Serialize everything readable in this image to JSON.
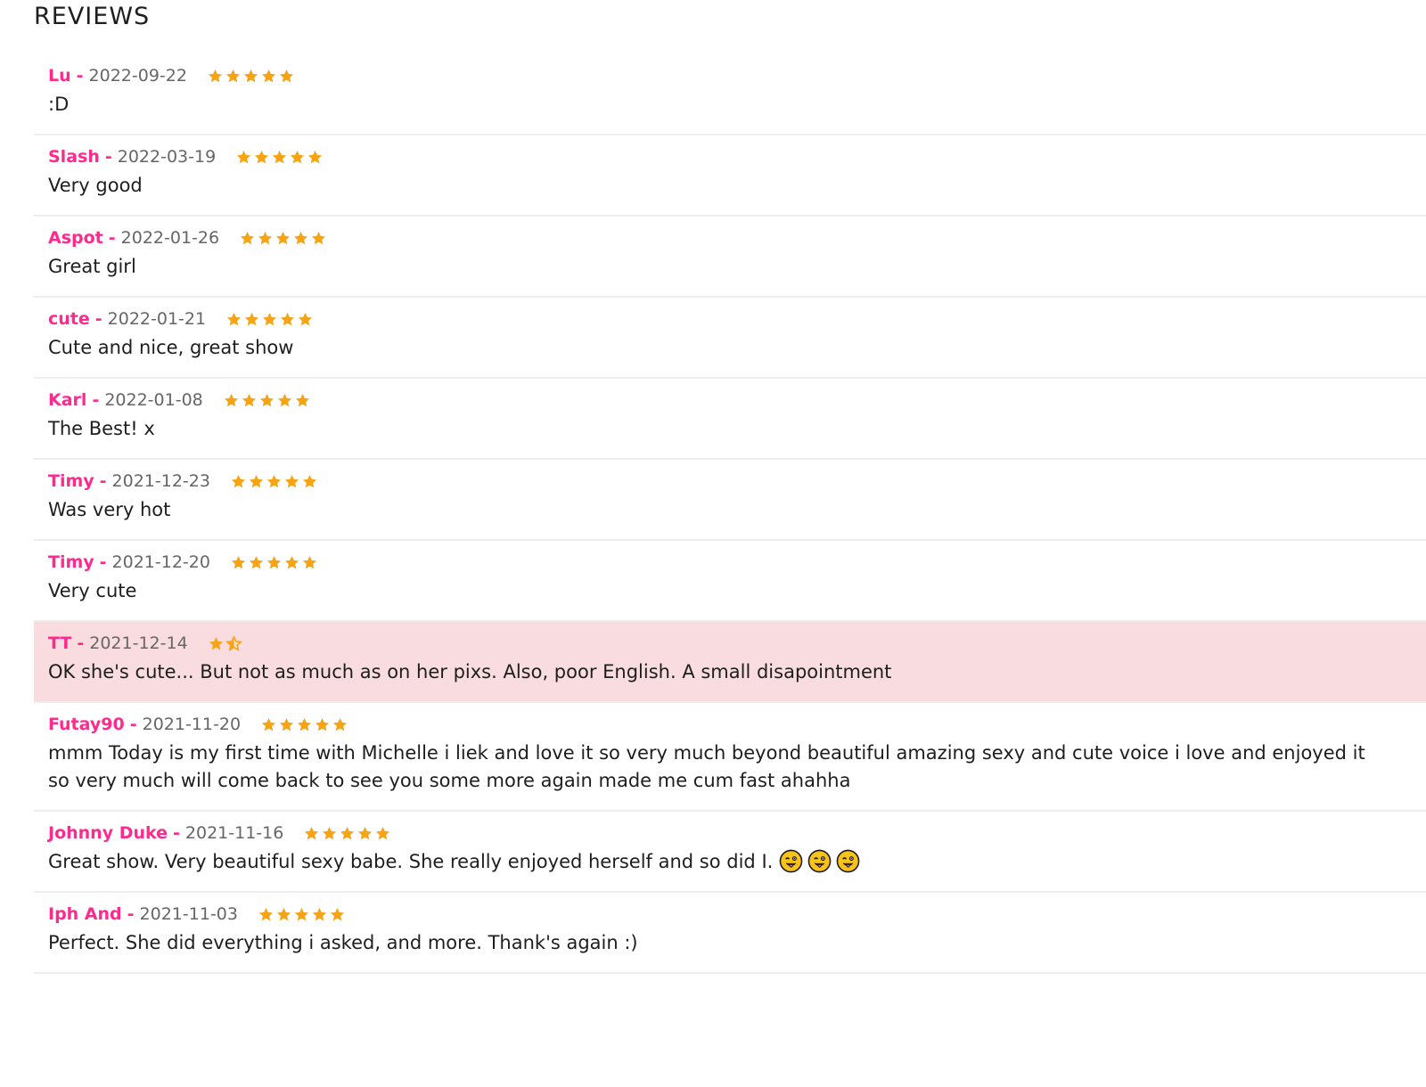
{
  "title": "REVIEWS",
  "colors": {
    "author": "#ff2a8e",
    "date": "#666666",
    "star": "#f6a414",
    "highlight_bg": "#f9dcdf"
  },
  "reviews": [
    {
      "author": "Lu",
      "sep": "-",
      "date": "2022-09-22",
      "rating": 5,
      "text": ":D",
      "highlight": false
    },
    {
      "author": "Slash",
      "sep": "-",
      "date": "2022-03-19",
      "rating": 5,
      "text": "Very good",
      "highlight": false
    },
    {
      "author": "Aspot",
      "sep": "-",
      "date": "2022-01-26",
      "rating": 5,
      "text": "Great girl",
      "highlight": false
    },
    {
      "author": "cute",
      "sep": "-",
      "date": "2022-01-21",
      "rating": 5,
      "text": "Cute and nice, great show",
      "highlight": false
    },
    {
      "author": "Karl",
      "sep": "-",
      "date": "2022-01-08",
      "rating": 5,
      "text": "The Best! x",
      "highlight": false
    },
    {
      "author": "Timy",
      "sep": "-",
      "date": "2021-12-23",
      "rating": 5,
      "text": "Was very hot",
      "highlight": false
    },
    {
      "author": "Timy",
      "sep": "-",
      "date": "2021-12-20",
      "rating": 5,
      "text": "Very cute",
      "highlight": false
    },
    {
      "author": "TT",
      "sep": "-",
      "date": "2021-12-14",
      "rating": 1.5,
      "text": "OK she's cute... But not as much as on her pixs. Also, poor English. A small disapointment",
      "highlight": true
    },
    {
      "author": "Futay90",
      "sep": "-",
      "date": "2021-11-20",
      "rating": 5,
      "text": "mmm Today is my first time with Michelle i liek and love it so very much beyond beautiful amazing sexy and cute voice i love and enjoyed it so very much will come back to see you some more again made me cum fast ahahha",
      "highlight": false
    },
    {
      "author": "Johnny Duke",
      "sep": "-",
      "date": "2021-11-16",
      "rating": 5,
      "text": "Great show. Very beautiful sexy babe. She really enjoyed herself and so did I.",
      "emoji_icons": [
        "tongue-face-emoji-icon",
        "tongue-face-emoji-icon",
        "tongue-face-emoji-icon"
      ],
      "highlight": false
    },
    {
      "author": "Iph And",
      "sep": "-",
      "date": "2021-11-03",
      "rating": 5,
      "text": "Perfect. She did everything i asked, and more. Thank's again :)",
      "highlight": false
    }
  ]
}
